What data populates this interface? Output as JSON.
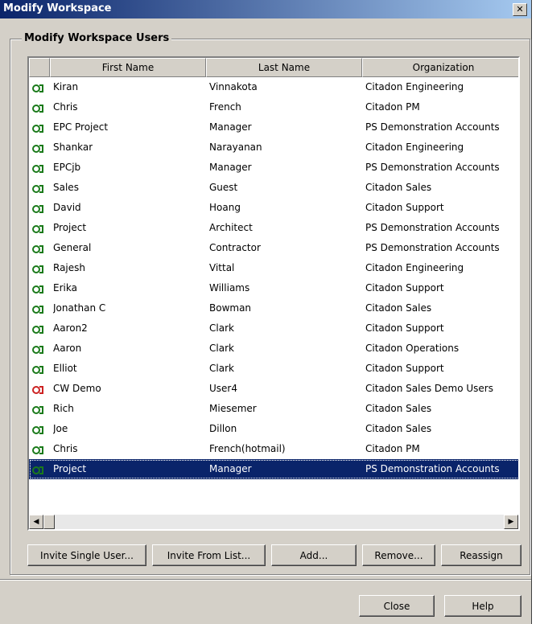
{
  "window": {
    "title": "Modify Workspace",
    "close_glyph": "✕"
  },
  "group": {
    "label": "Modify Workspace Users"
  },
  "table": {
    "columns": [
      "First Name",
      "Last Name",
      "Organization"
    ],
    "rows": [
      {
        "first": "Kiran",
        "last": "Vinnakota",
        "org": "Citadon Engineering",
        "icon": "user-active-icon"
      },
      {
        "first": "Chris",
        "last": "French",
        "org": "Citadon PM",
        "icon": "user-active-icon"
      },
      {
        "first": "EPC Project",
        "last": "Manager",
        "org": "PS Demonstration Accounts",
        "icon": "user-active-icon"
      },
      {
        "first": "Shankar",
        "last": "Narayanan",
        "org": "Citadon Engineering",
        "icon": "user-active-icon"
      },
      {
        "first": "EPCjb",
        "last": "Manager",
        "org": "PS Demonstration Accounts",
        "icon": "user-active-icon"
      },
      {
        "first": "Sales",
        "last": "Guest",
        "org": "Citadon Sales",
        "icon": "user-active-icon"
      },
      {
        "first": "David",
        "last": "Hoang",
        "org": "Citadon Support",
        "icon": "user-active-icon"
      },
      {
        "first": "Project",
        "last": "Architect",
        "org": "PS Demonstration Accounts",
        "icon": "user-active-icon"
      },
      {
        "first": "General",
        "last": "Contractor",
        "org": "PS Demonstration Accounts",
        "icon": "user-active-icon"
      },
      {
        "first": "Rajesh",
        "last": "Vittal",
        "org": "Citadon Engineering",
        "icon": "user-active-icon"
      },
      {
        "first": "Erika",
        "last": "Williams",
        "org": "Citadon Support",
        "icon": "user-active-icon"
      },
      {
        "first": "Jonathan C",
        "last": "Bowman",
        "org": "Citadon Sales",
        "icon": "user-active-icon"
      },
      {
        "first": "Aaron2",
        "last": "Clark",
        "org": "Citadon Support",
        "icon": "user-active-icon"
      },
      {
        "first": "Aaron",
        "last": "Clark",
        "org": "Citadon Operations",
        "icon": "user-active-icon"
      },
      {
        "first": "Elliot",
        "last": "Clark",
        "org": "Citadon Support",
        "icon": "user-active-icon"
      },
      {
        "first": "CW Demo",
        "last": "User4",
        "org": "Citadon Sales Demo Users",
        "icon": "user-pending-icon"
      },
      {
        "first": "Rich",
        "last": "Miesemer",
        "org": "Citadon Sales",
        "icon": "user-active-icon"
      },
      {
        "first": "Joe",
        "last": "Dillon",
        "org": "Citadon Sales",
        "icon": "user-active-icon"
      },
      {
        "first": "Chris",
        "last": "French(hotmail)",
        "org": "Citadon PM",
        "icon": "user-active-icon"
      },
      {
        "first": "Project",
        "last": "Manager",
        "org": "PS Demonstration Accounts",
        "icon": "user-active-icon",
        "selected": true
      }
    ]
  },
  "buttons": {
    "invite_single": "Invite Single User...",
    "invite_list": "Invite From List...",
    "add": "Add...",
    "remove": "Remove...",
    "reassign": "Reassign",
    "close": "Close",
    "help": "Help"
  },
  "scroll": {
    "left_glyph": "◀",
    "right_glyph": "▶"
  },
  "colors": {
    "selection": "#0a246a",
    "face": "#d4d0c8",
    "user_icon": "#1a7a1a",
    "pending_icon": "#cc2222"
  }
}
